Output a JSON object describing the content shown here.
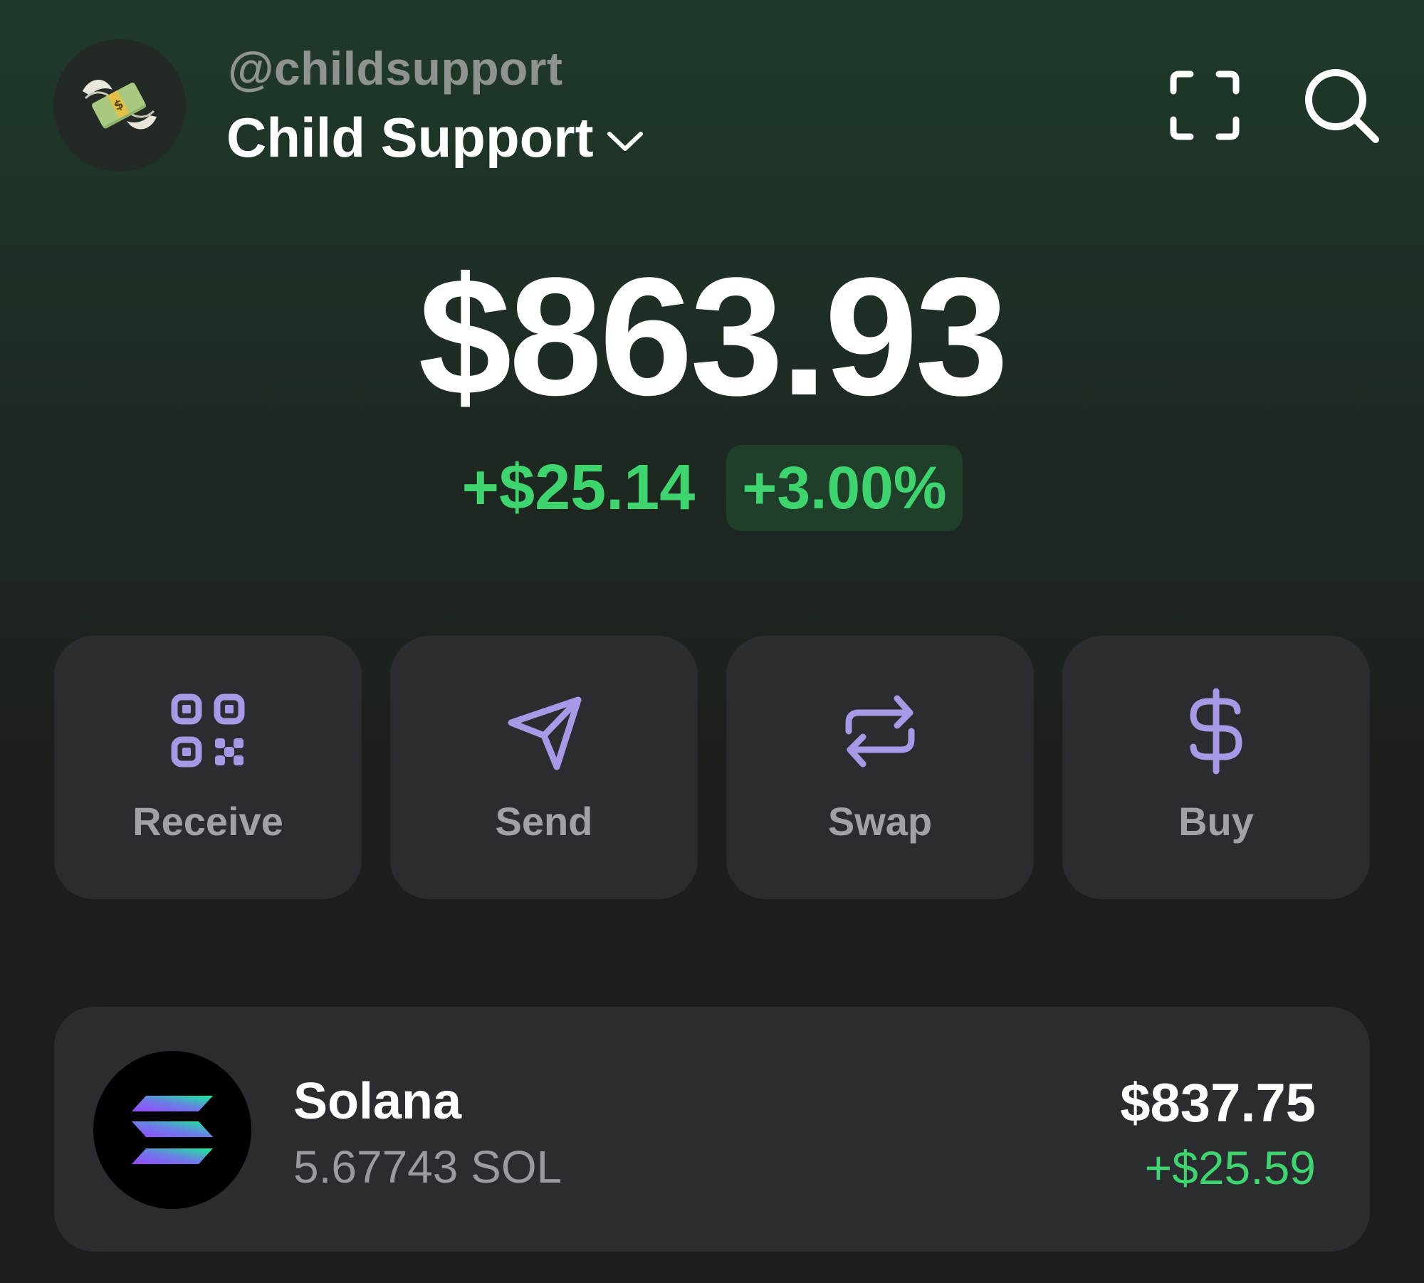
{
  "header": {
    "handle": "@childsupport",
    "account_name": "Child Support",
    "avatar_icon": "money-with-wings-icon",
    "scan_icon": "scan-frame-icon",
    "search_icon": "search-icon"
  },
  "balance": {
    "total": "$863.93",
    "change_amount": "+$25.14",
    "change_percent": "+3.00%"
  },
  "actions": [
    {
      "label": "Receive",
      "icon": "qr-code-icon"
    },
    {
      "label": "Send",
      "icon": "paper-plane-icon"
    },
    {
      "label": "Swap",
      "icon": "swap-arrows-icon"
    },
    {
      "label": "Buy",
      "icon": "dollar-icon"
    }
  ],
  "tokens": [
    {
      "name": "Solana",
      "amount": "5.67743 SOL",
      "value": "$837.75",
      "change": "+$25.59",
      "icon": "solana-logo-icon"
    }
  ],
  "colors": {
    "accent_purple": "#a899e6",
    "positive_green": "#3ed56e",
    "card_bg": "#2b2c30"
  }
}
